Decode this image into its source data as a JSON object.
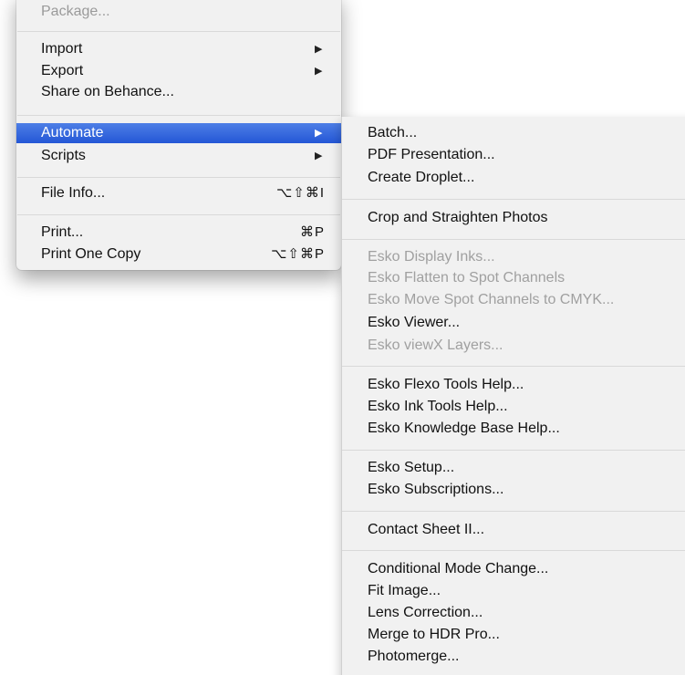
{
  "file_menu": {
    "package_label": "Package...",
    "import_label": "Import",
    "export_label": "Export",
    "share_behance_label": "Share on Behance...",
    "automate_label": "Automate",
    "scripts_label": "Scripts",
    "file_info_label": "File Info...",
    "file_info_shortcut": "⌥⇧⌘I",
    "print_label": "Print...",
    "print_shortcut": "⌘P",
    "print_one_copy_label": "Print One Copy",
    "print_one_copy_shortcut": "⌥⇧⌘P",
    "submenu_arrow": "▶"
  },
  "automate_submenu": {
    "batch": "Batch...",
    "pdf_presentation": "PDF Presentation...",
    "create_droplet": "Create Droplet...",
    "crop_straighten": "Crop and Straighten Photos",
    "esko_display_inks": "Esko Display Inks...",
    "esko_flatten_spot": "Esko Flatten to Spot Channels",
    "esko_move_spot": "Esko Move Spot Channels to CMYK...",
    "esko_viewer": "Esko Viewer...",
    "esko_viewx_layers": "Esko viewX Layers...",
    "esko_flexo_help": "Esko Flexo Tools Help...",
    "esko_ink_help": "Esko Ink Tools Help...",
    "esko_kb_help": "Esko Knowledge Base Help...",
    "esko_setup": "Esko Setup...",
    "esko_subscriptions": "Esko Subscriptions...",
    "contact_sheet": "Contact Sheet II...",
    "conditional_mode": "Conditional Mode Change...",
    "fit_image": "Fit Image...",
    "lens_correction": "Lens Correction...",
    "merge_hdr": "Merge to HDR Pro...",
    "photomerge": "Photomerge..."
  },
  "colors": {
    "highlight": "#2f63dc",
    "menu_bg": "#f1f1f1",
    "disabled_text": "#9a9a9a"
  }
}
